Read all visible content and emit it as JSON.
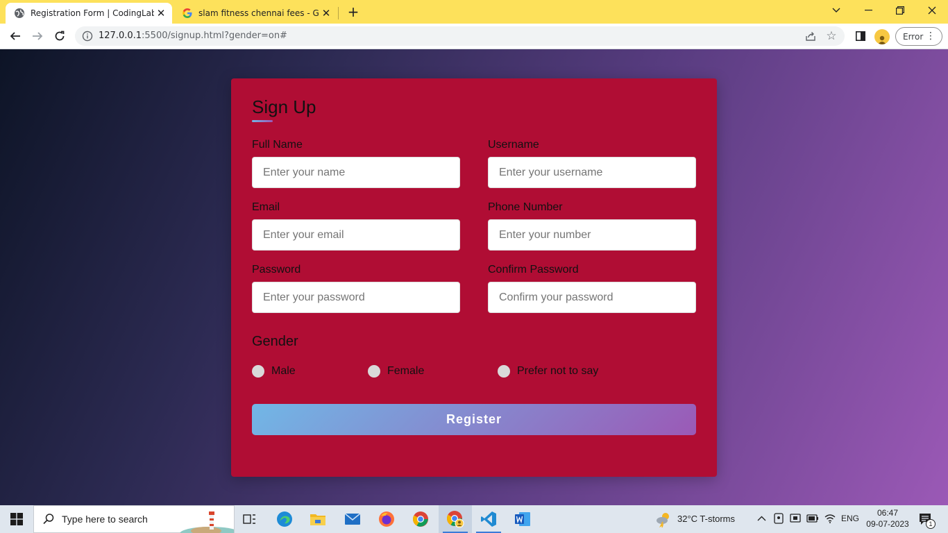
{
  "browser": {
    "tabs": [
      {
        "title": "Registration Form | CodingLab",
        "active": true
      },
      {
        "title": "slam fitness chennai fees - Goog",
        "active": false
      }
    ],
    "url_main": "127.0.0.1",
    "url_rest": ":5500/signup.html?gender=on#",
    "error_label": "Error"
  },
  "form": {
    "title": "Sign Up",
    "fields": [
      {
        "label": "Full Name",
        "placeholder": "Enter your name"
      },
      {
        "label": "Username",
        "placeholder": "Enter your username"
      },
      {
        "label": "Email",
        "placeholder": "Enter your email"
      },
      {
        "label": "Phone Number",
        "placeholder": "Enter your number"
      },
      {
        "label": "Password",
        "placeholder": "Enter your password"
      },
      {
        "label": "Confirm Password",
        "placeholder": "Confirm your password"
      }
    ],
    "gender_title": "Gender",
    "gender_options": [
      "Male",
      "Female",
      "Prefer not to say"
    ],
    "register_label": "Register"
  },
  "taskbar": {
    "search_placeholder": "Type here to search",
    "weather": "32°C  T-storms",
    "language": "ENG",
    "time": "06:47",
    "date": "09-07-2023",
    "notification_count": "1"
  },
  "colors": {
    "tabstrip": "#fde15b",
    "card": "#b00d34",
    "button_gradient_start": "#71b7e6",
    "button_gradient_end": "#9b59b6"
  }
}
